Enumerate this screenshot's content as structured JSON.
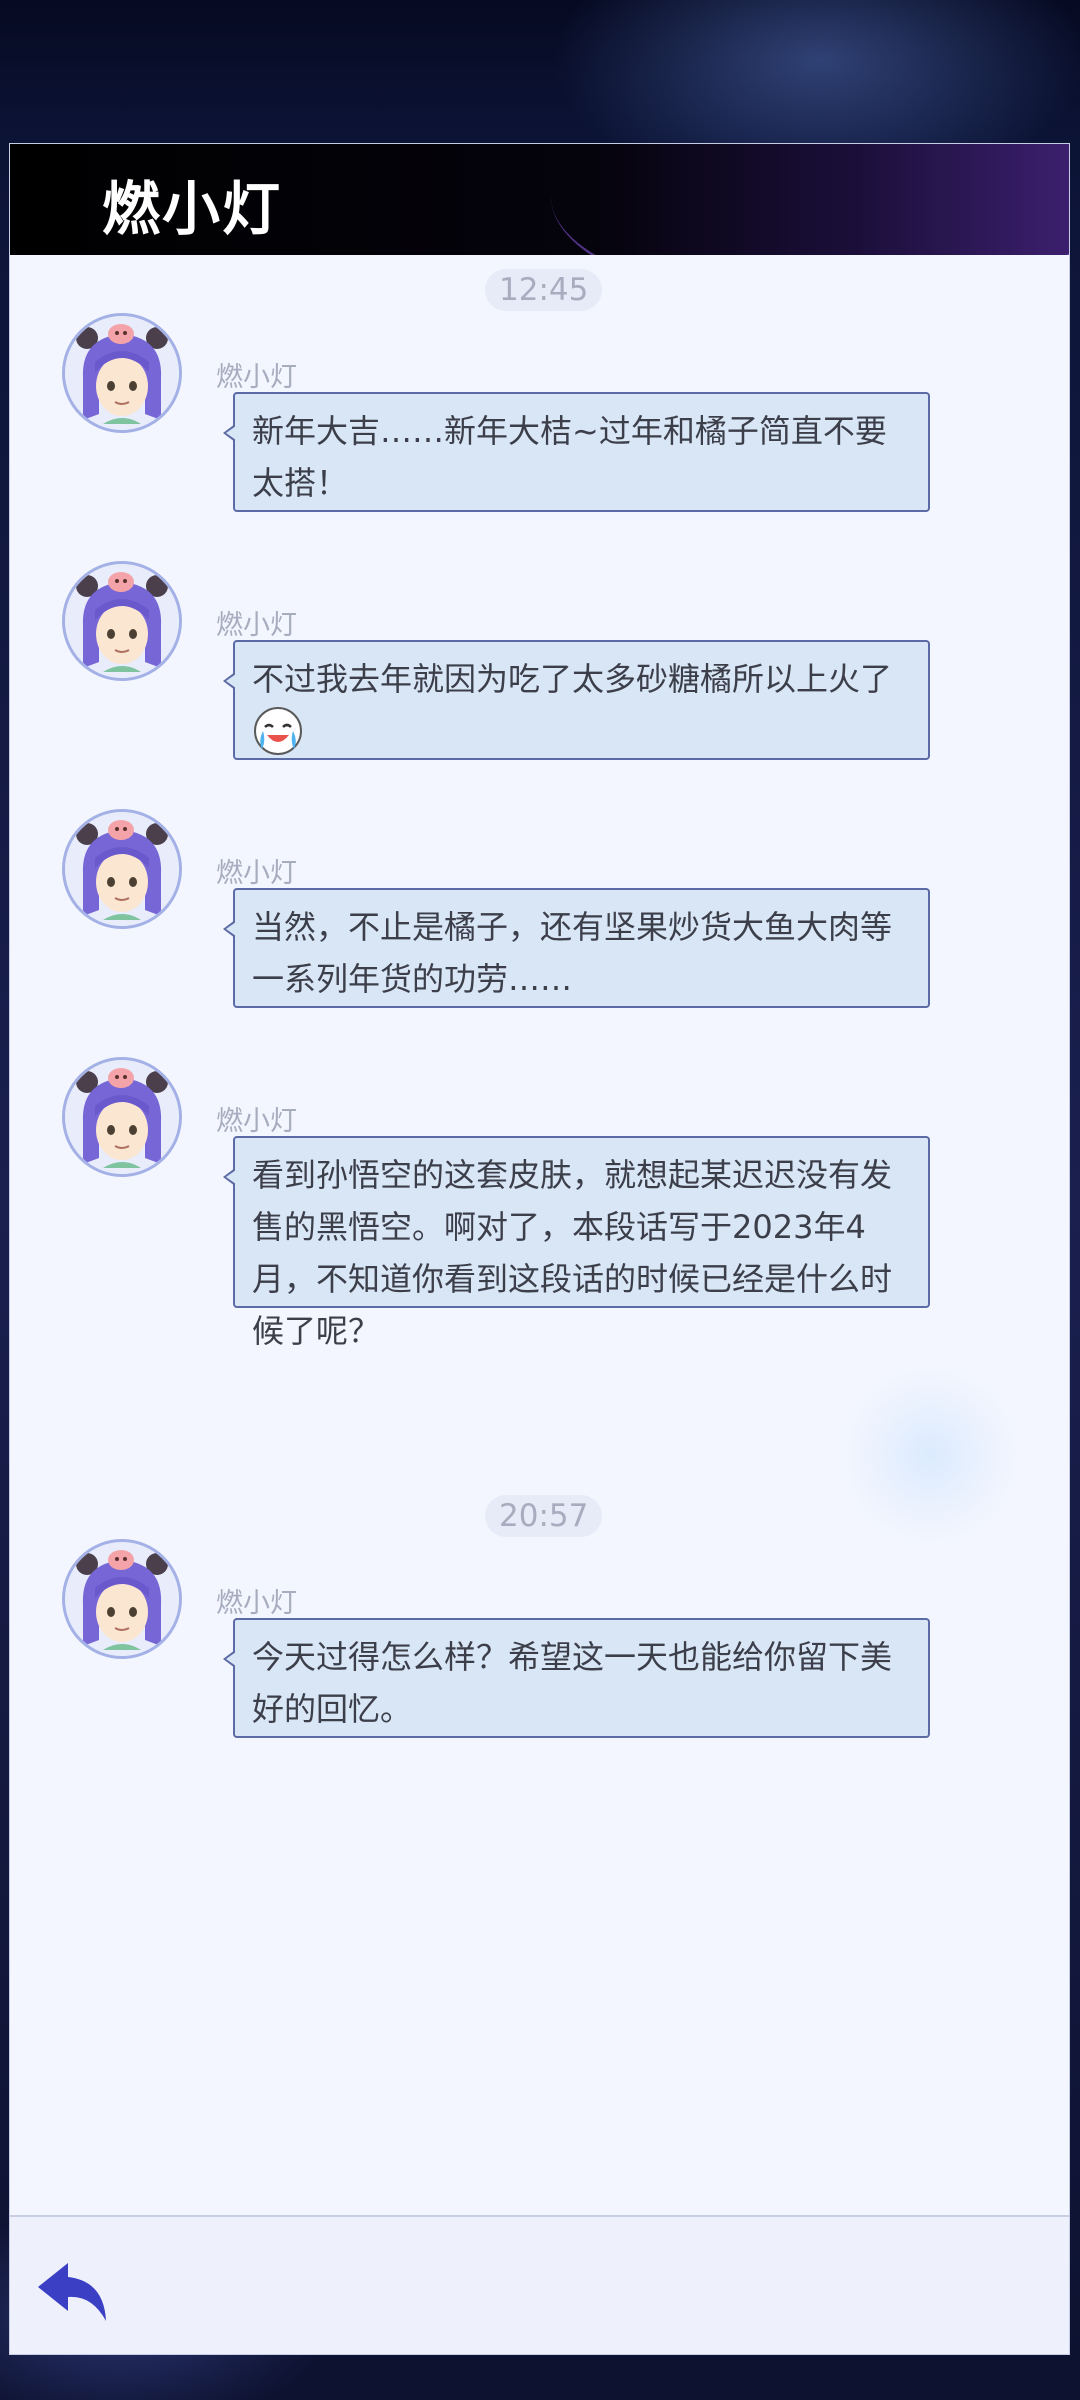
{
  "header": {
    "title": "燃小灯"
  },
  "timestamps": [
    "12:45",
    "20:57"
  ],
  "messages": [
    {
      "sender": "燃小灯",
      "text": "新年大吉……新年大桔~过年和橘子简直不要太搭！"
    },
    {
      "sender": "燃小灯",
      "text": "不过我去年就因为吃了太多砂糖橘所以上火了",
      "emoji": "crying-laughing-face"
    },
    {
      "sender": "燃小灯",
      "text": "当然，不止是橘子，还有坚果炒货大鱼大肉等一系列年货的功劳……"
    },
    {
      "sender": "燃小灯",
      "text": "看到孙悟空的这套皮肤，就想起某迟迟没有发售的黑悟空。啊对了，本段话写于2023年4月，不知道你看到这段话的时候已经是什么时候了呢？"
    },
    {
      "sender": "燃小灯",
      "text": "今天过得怎么样？希望这一天也能给你留下美好的回忆。"
    }
  ],
  "footer": {
    "back_icon": "back-arrow-icon"
  },
  "colors": {
    "bubble_bg": "#d9e6f6",
    "bubble_border": "#5c6aa6",
    "accent_back": "#3b3fc4",
    "header_bg": "#000000"
  }
}
